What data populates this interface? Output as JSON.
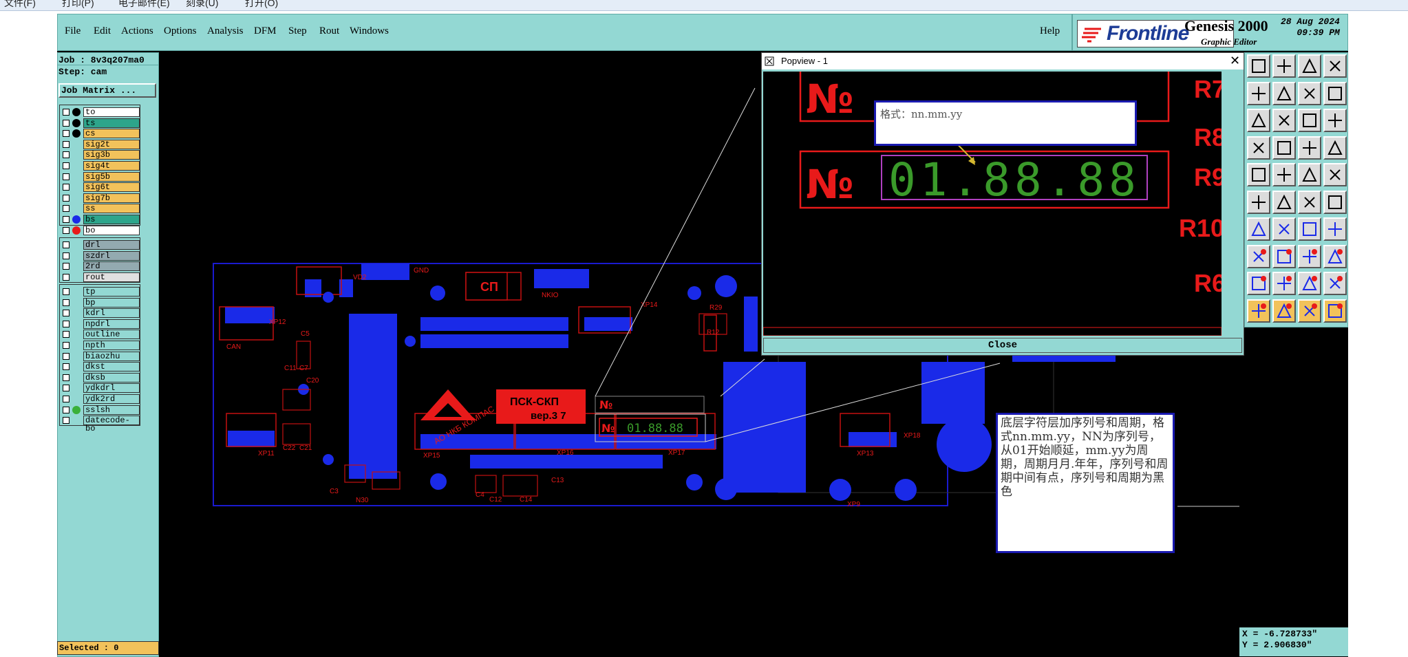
{
  "os_menu": [
    "文件(F)",
    "打印(P)",
    "电子邮件(E)",
    "刻录(U)",
    "打开(O)"
  ],
  "menu": {
    "left": [
      "File",
      "Edit",
      "Actions",
      "Options",
      "Analysis",
      "DFM",
      "Step",
      "Rout",
      "Windows"
    ],
    "help": "Help"
  },
  "logo": {
    "brand": "Frontline",
    "product": "Genesis 2000",
    "subtitle": "Graphic Editor",
    "date": "28 Aug 2024",
    "time": "09:39 PM"
  },
  "job": {
    "job_label": "Job : 8v3q207ma0",
    "step_label": "Step: cam",
    "matrix_button": "Job Matrix ..."
  },
  "layers": [
    {
      "name": "to",
      "color": "#ffffff",
      "swatch": "#000000"
    },
    {
      "name": "ts",
      "color": "#2da58b",
      "swatch": "#000000"
    },
    {
      "name": "cs",
      "color": "#f2c25b",
      "swatch": "#000000"
    },
    {
      "name": "sig2t",
      "color": "#f2c25b",
      "swatch": ""
    },
    {
      "name": "sig3b",
      "color": "#f2c25b",
      "swatch": ""
    },
    {
      "name": "sig4t",
      "color": "#f2c25b",
      "swatch": ""
    },
    {
      "name": "sig5b",
      "color": "#f2c25b",
      "swatch": ""
    },
    {
      "name": "sig6t",
      "color": "#f2c25b",
      "swatch": ""
    },
    {
      "name": "sig7b",
      "color": "#f2c25b",
      "swatch": ""
    },
    {
      "name": "ss",
      "color": "#f2c25b",
      "swatch": ""
    },
    {
      "name": "bs",
      "color": "#2da58b",
      "swatch": "#1a2ae8"
    },
    {
      "name": "bo",
      "color": "#ffffff",
      "swatch": "#e81a1a"
    }
  ],
  "drill_layers": [
    {
      "name": "drl",
      "color": "#93aab0"
    },
    {
      "name": "szdrl",
      "color": "#93aab0"
    },
    {
      "name": "2rd",
      "color": "#93aab0"
    },
    {
      "name": "rout",
      "color": "#e0e0e0"
    }
  ],
  "misc_layers": [
    {
      "name": "tp",
      "color": "#93d8d3",
      "swatch": ""
    },
    {
      "name": "bp",
      "color": "#93d8d3",
      "swatch": ""
    },
    {
      "name": "kdrl",
      "color": "#93d8d3",
      "swatch": ""
    },
    {
      "name": "npdrl",
      "color": "#93d8d3",
      "swatch": ""
    },
    {
      "name": "outline",
      "color": "#93d8d3",
      "swatch": ""
    },
    {
      "name": "npth",
      "color": "#93d8d3",
      "swatch": ""
    },
    {
      "name": "biaozhu",
      "color": "#93d8d3",
      "swatch": ""
    },
    {
      "name": "dkst",
      "color": "#93d8d3",
      "swatch": ""
    },
    {
      "name": "dksb",
      "color": "#93d8d3",
      "swatch": ""
    },
    {
      "name": "ydkdrl",
      "color": "#93d8d3",
      "swatch": ""
    },
    {
      "name": "ydk2rd",
      "color": "#93d8d3",
      "swatch": ""
    },
    {
      "name": "sslsh",
      "color": "#93d8d3",
      "swatch": "#3ab03a"
    },
    {
      "name": "datecode-bo",
      "color": "#93d8d3",
      "swatch": ""
    }
  ],
  "selected": "Selected : 0",
  "popview": {
    "title": "Popview - 1",
    "close_label": "Close",
    "format_note": "格式：nn.mm.yy",
    "digits": "01.88.88",
    "no_label": "№",
    "r_labels": [
      "R7",
      "R8",
      "R9",
      "R10",
      "R6"
    ]
  },
  "board": {
    "sp_label": "СП",
    "psk_title": "ПСК-СКП",
    "psk_ver": "вер.3 7",
    "no_mini": "№",
    "digits_mini": "01.88.88",
    "kompas": "АО НКБ КОМПАС",
    "labels": [
      "CAN",
      "XP12",
      "XP11",
      "XP15",
      "XP16",
      "XP17",
      "XP14",
      "XP18",
      "XP13",
      "XP9",
      "C5",
      "C11",
      "C7",
      "C20",
      "C22",
      "C21",
      "C3",
      "C4",
      "C12",
      "C14",
      "C13",
      "VD2",
      "NKIO",
      "N30",
      "R29",
      "R12",
      "GND"
    ]
  },
  "note_text": "底层字符层加序列号和周期，格式nn.mm.yy，NN为序列号，从01开始顺延，mm.yy为周期，周期月月.年年，序列号和周期中间有点，序列号和周期为黑色",
  "coords": {
    "x": "X = -6.728733\"",
    "y": "Y = 2.906830\""
  }
}
